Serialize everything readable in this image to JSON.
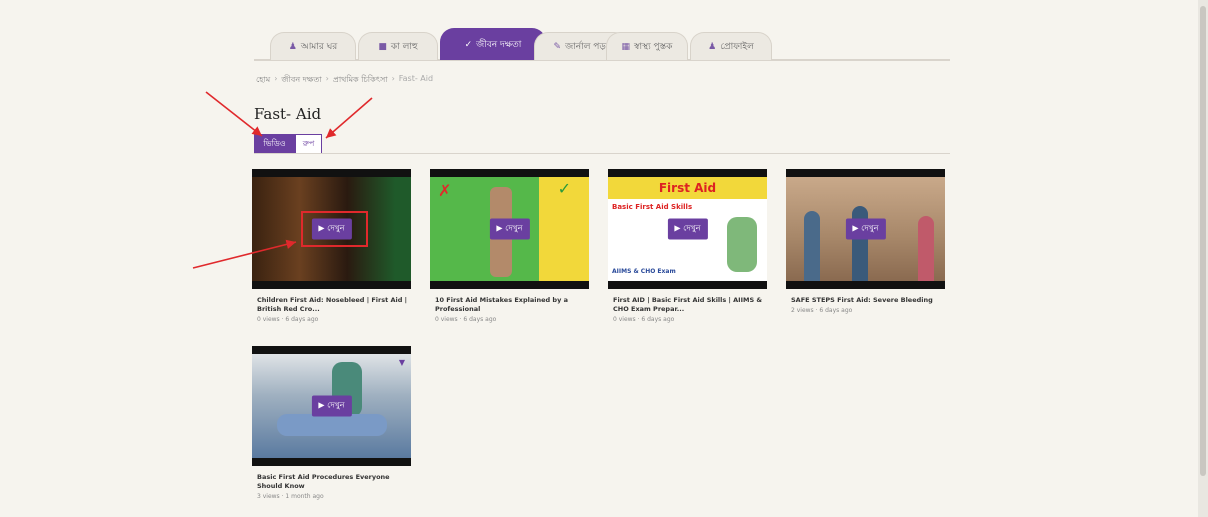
{
  "nav": {
    "tabs": [
      {
        "label": "আমার ঘর",
        "icon": "person-icon"
      },
      {
        "label": "কা লাহু",
        "icon": "briefcase-icon"
      },
      {
        "label": "জীবন দক্ষতা",
        "icon": "check-icon",
        "active": true
      },
      {
        "label": "জার্নাল পড়া",
        "icon": "pencil-icon"
      },
      {
        "label": "স্বাস্থ্য পুস্তক",
        "icon": "book-icon"
      },
      {
        "label": "প্রোফাইল",
        "icon": "person-icon"
      }
    ]
  },
  "breadcrumb": {
    "items": [
      "হোম",
      "জীবন দক্ষতা",
      "প্রাথমিক চিকিৎসা"
    ],
    "current": "Fast- Aid"
  },
  "page": {
    "title": "Fast- Aid"
  },
  "view_toggle": {
    "video_label": "ভিডিও",
    "list_label": "রুপ"
  },
  "play_label": "▶ দেখুন",
  "videos": [
    {
      "title": "Children First Aid: Nosebleed | First Aid | British Red Cro...",
      "meta": "0 views · 6 days ago"
    },
    {
      "title": "10 First Aid Mistakes Explained by a Professional",
      "meta": "0 views · 6 days ago"
    },
    {
      "title": "First AID | Basic First Aid Skills | AIIMS & CHO Exam Prepar...",
      "meta": "0 views · 6 days ago"
    },
    {
      "title": "SAFE STEPS First Aid: Severe Bleeding",
      "meta": "2 views · 6 days ago"
    },
    {
      "title": "Basic First Aid Procedures Everyone Should Know",
      "meta": "3 views · 1 month ago"
    }
  ],
  "thumb_text": {
    "banner": "First Aid",
    "sub": "Basic First Aid Skills",
    "foot": "AIIMS & CHO Exam"
  },
  "colors": {
    "accent": "#6a3fa0",
    "annotation": "#e0292c",
    "background": "#f6f4ee"
  }
}
